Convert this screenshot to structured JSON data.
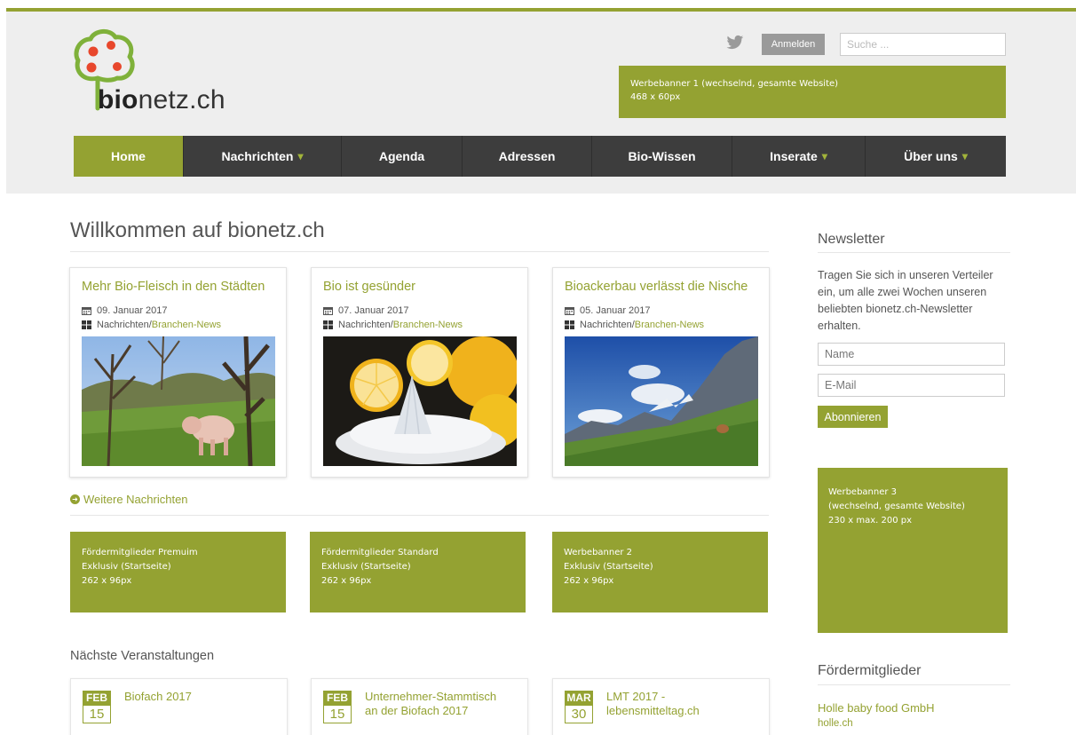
{
  "header": {
    "logo_bold": "bio",
    "logo_rest": "netz.ch",
    "login_label": "Anmelden",
    "search_placeholder": "Suche ...",
    "banner1_line1": "Werbebanner 1 (wechselnd, gesamte Website)",
    "banner1_line2": "468 x 60px",
    "icons": {
      "twitter": "twitter-icon"
    },
    "colors": {
      "accent": "#94a232",
      "nav": "#3d3d3d",
      "header_bg": "#eeeeee"
    }
  },
  "nav": {
    "items": [
      {
        "label": "Home",
        "active": true
      },
      {
        "label": "Nachrichten",
        "dropdown": true
      },
      {
        "label": "Agenda"
      },
      {
        "label": "Adressen"
      },
      {
        "label": "Bio-Wissen"
      },
      {
        "label": "Inserate",
        "dropdown": true
      },
      {
        "label": "Über uns",
        "dropdown": true
      }
    ],
    "caret": "▾"
  },
  "main": {
    "welcome_title": "Willkommen auf bionetz.ch",
    "news": [
      {
        "title": "Mehr Bio-Fleisch in den Städten",
        "date": "09. Januar 2017",
        "category": "Nachrichten",
        "sep": " / ",
        "subcategory": "Branchen-News"
      },
      {
        "title": "Bio ist gesünder",
        "date": "07. Januar 2017",
        "category": "Nachrichten",
        "sep": " / ",
        "subcategory": "Branchen-News"
      },
      {
        "title": "Bioackerbau verlässt die Nische",
        "date": "05. Januar 2017",
        "category": "Nachrichten",
        "sep": " / ",
        "subcategory": "Branchen-News"
      }
    ],
    "more_news": "Weitere Nachrichten",
    "sponsors": [
      {
        "line1": "Fördermitglieder Premuim",
        "line2": "Exklusiv (Startseite)",
        "line3": "262 x 96px"
      },
      {
        "line1": "Fördermitglieder Standard",
        "line2": "Exklusiv (Startseite)",
        "line3": "262 x 96px"
      },
      {
        "line1": "Werbebanner 2",
        "line2": "Exklusiv (Startseite)",
        "line3": "262 x 96px"
      }
    ],
    "events_title": "Nächste Veranstaltungen",
    "events": [
      {
        "month": "FEB",
        "day": "15",
        "title_line1": "Biofach 2017",
        "title_line2": ""
      },
      {
        "month": "FEB",
        "day": "15",
        "title_line1": "Unternehmer-Stammtisch",
        "title_line2": "an der Biofach 2017"
      },
      {
        "month": "MAR",
        "day": "30",
        "title_line1": "LMT 2017 -",
        "title_line2": "lebensmitteltag.ch"
      }
    ]
  },
  "sidebar": {
    "newsletter_title": "Newsletter",
    "newsletter_text": "Tragen Sie sich in unseren Verteiler ein, um alle zwei Wochen unseren beliebten bionetz.ch-Newsletter erhalten.",
    "name_placeholder": "Name",
    "email_placeholder": "E-Mail",
    "subscribe_label": "Abonnieren",
    "banner3_line1": "Werbebanner 3",
    "banner3_line2": "(wechselnd, gesamte Website)",
    "banner3_line3": "230 x max. 200 px",
    "members_title": "Fördermitglieder",
    "member_name": "Holle baby food GmbH",
    "member_url": "holle.ch"
  }
}
